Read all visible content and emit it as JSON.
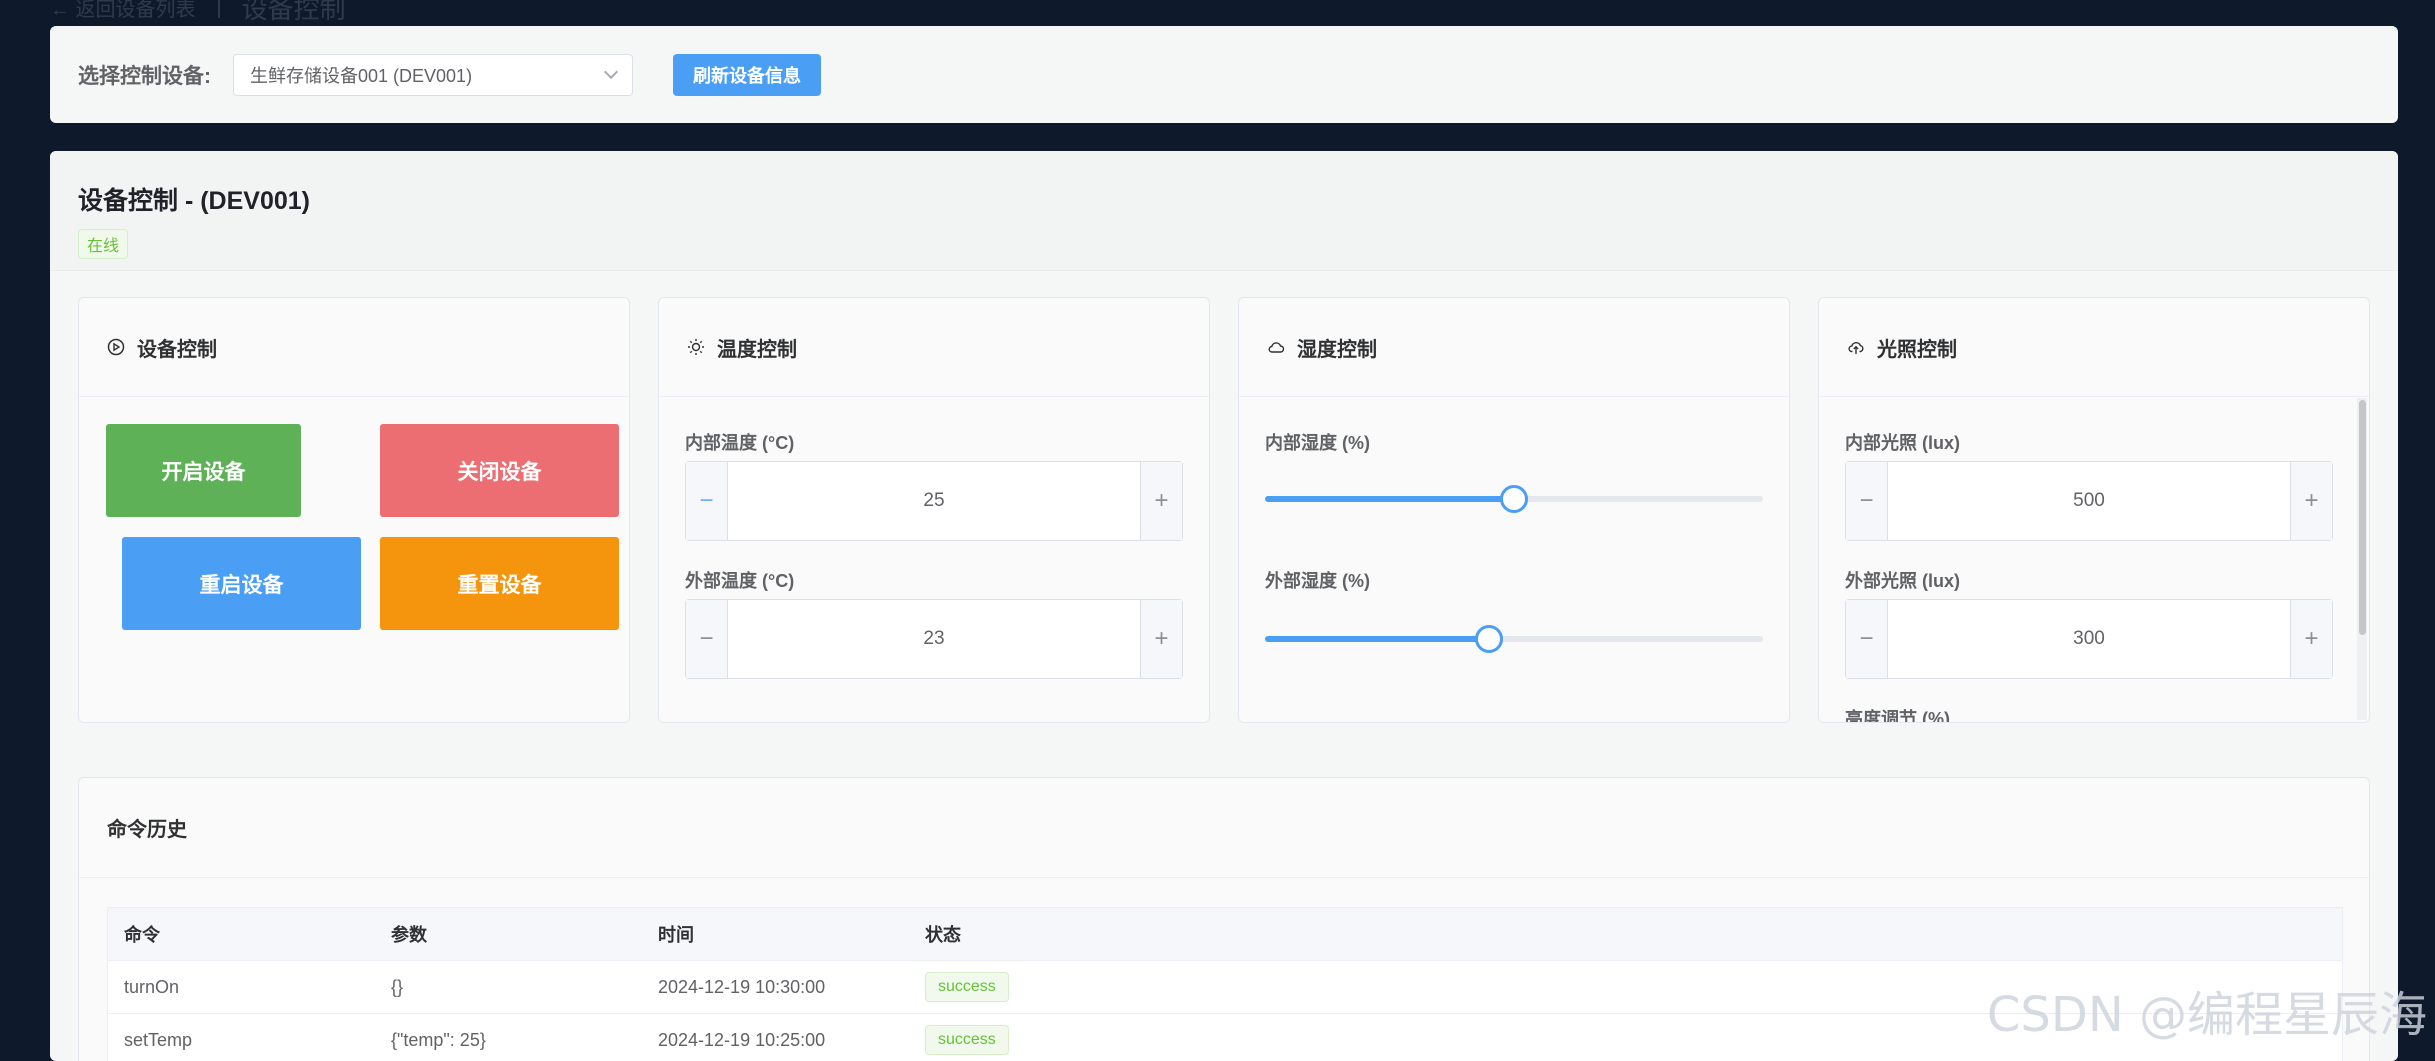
{
  "topbar": {
    "back_label": "← 返回设备列表",
    "page_title": "设备控制"
  },
  "device_select": {
    "label": "选择控制设备:",
    "selected": "生鲜存储设备001 (DEV001)",
    "refresh_label": "刷新设备信息"
  },
  "header": {
    "title": "设备控制 - (DEV001)",
    "status": "在线"
  },
  "device_ctrl": {
    "title": "设备控制",
    "on_label": "开启设备",
    "off_label": "关闭设备",
    "restart_label": "重启设备",
    "reset_label": "重置设备",
    "colors": {
      "on": "#5fb157",
      "off": "#ec6d72",
      "restart": "#4a9ff5",
      "reset": "#f5950d"
    }
  },
  "temp_ctrl": {
    "title": "温度控制",
    "inner_label": "内部温度 (°C)",
    "inner_value": "25",
    "outer_label": "外部温度 (°C)",
    "outer_value": "23"
  },
  "humid_ctrl": {
    "title": "湿度控制",
    "inner_label": "内部湿度 (%)",
    "inner_value": 50,
    "outer_label": "外部湿度 (%)",
    "outer_value": 45
  },
  "light_ctrl": {
    "title": "光照控制",
    "inner_label": "内部光照 (lux)",
    "inner_value": "500",
    "outer_label": "外部光照 (lux)",
    "outer_value": "300",
    "brightness_label": "亮度调节 (%)"
  },
  "history": {
    "title": "命令历史",
    "columns": [
      "命令",
      "参数",
      "时间",
      "状态"
    ],
    "rows": [
      {
        "command": "turnOn",
        "params": "{}",
        "time": "2024-12-19 10:30:00",
        "status": "success"
      },
      {
        "command": "setTemp",
        "params": "{\"temp\": 25}",
        "time": "2024-12-19 10:25:00",
        "status": "success"
      }
    ]
  },
  "watermark": "CSDN @编程星辰海"
}
